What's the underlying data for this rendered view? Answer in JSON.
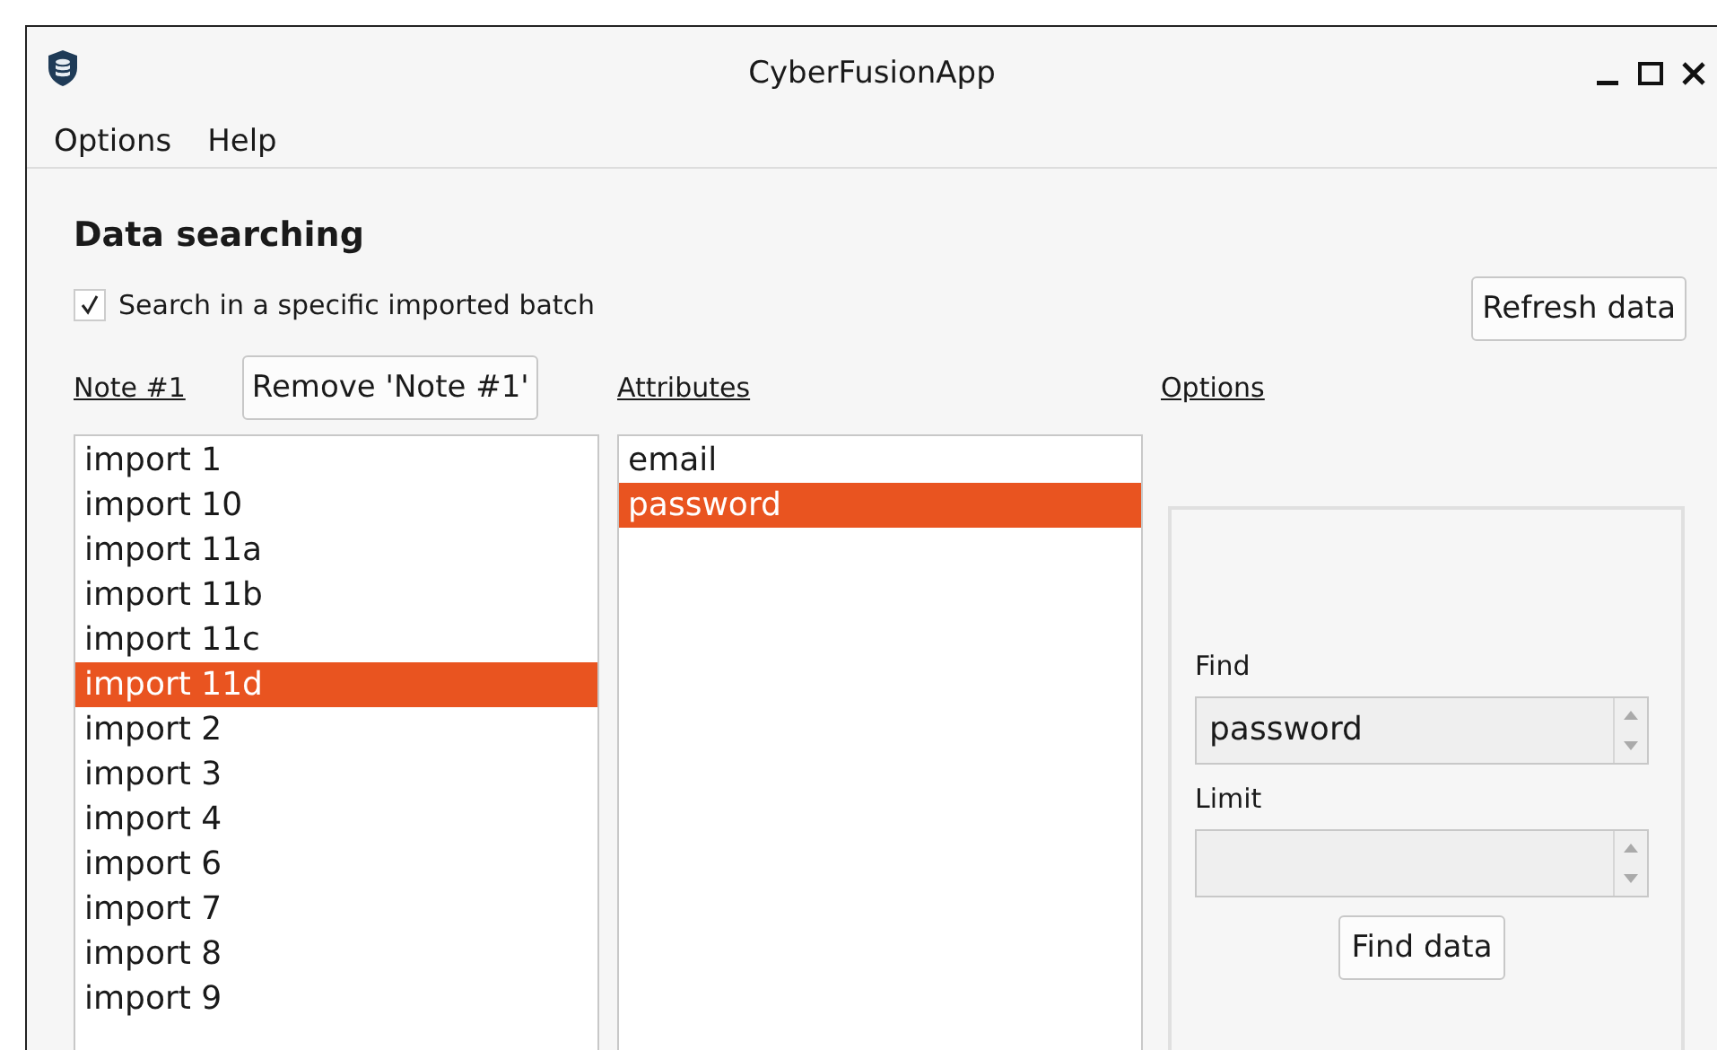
{
  "window": {
    "title": "CyberFusionApp"
  },
  "menu": [
    "Options",
    "Help"
  ],
  "section_title": "Data searching",
  "batch_checkbox": {
    "label": "Search in a specific imported batch",
    "checked": true
  },
  "refresh_button": "Refresh data",
  "note_label": "Note #1",
  "remove_button": "Remove 'Note #1'",
  "attributes_label": "Attributes",
  "options_label": "Options",
  "imports": [
    {
      "label": "import 1",
      "selected": false
    },
    {
      "label": "import 10",
      "selected": false
    },
    {
      "label": "import 11a",
      "selected": false
    },
    {
      "label": "import 11b",
      "selected": false
    },
    {
      "label": "import 11c",
      "selected": false
    },
    {
      "label": "import 11d",
      "selected": true
    },
    {
      "label": "import 2",
      "selected": false
    },
    {
      "label": "import 3",
      "selected": false
    },
    {
      "label": "import 4",
      "selected": false
    },
    {
      "label": "import 6",
      "selected": false
    },
    {
      "label": "import 7",
      "selected": false
    },
    {
      "label": "import 8",
      "selected": false
    },
    {
      "label": "import 9",
      "selected": false
    }
  ],
  "attributes": [
    {
      "label": "email",
      "selected": false
    },
    {
      "label": "password",
      "selected": true
    }
  ],
  "find": {
    "label": "Find",
    "value": "password"
  },
  "limit": {
    "label": "Limit"
  },
  "find_button": "Find data"
}
